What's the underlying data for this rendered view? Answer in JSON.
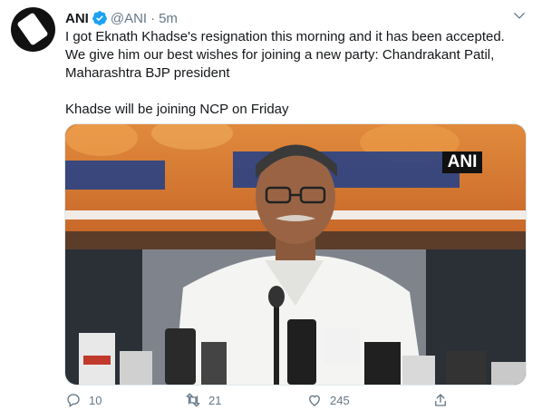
{
  "tweet": {
    "author_name": "ANI",
    "handle": "@ANI",
    "separator": "·",
    "timestamp": "5m",
    "text_line1": "I got Eknath Khadse's resignation this morning and it has been accepted. We give him our best wishes for joining a new party: Chandrakant Patil, Maharashtra BJP president",
    "text_line2": "Khadse will be joining NCP on Friday",
    "media_watermark": "ANI",
    "counts": {
      "replies": "10",
      "retweets": "21",
      "likes": "245"
    }
  },
  "icons": {
    "verified": "verified-badge-icon",
    "more": "chevron-down-icon",
    "reply": "reply-icon",
    "retweet": "retweet-icon",
    "like": "heart-icon",
    "share": "share-icon"
  },
  "colors": {
    "accent": "#1da1f2",
    "text": "#14171a",
    "secondary": "#657786"
  }
}
